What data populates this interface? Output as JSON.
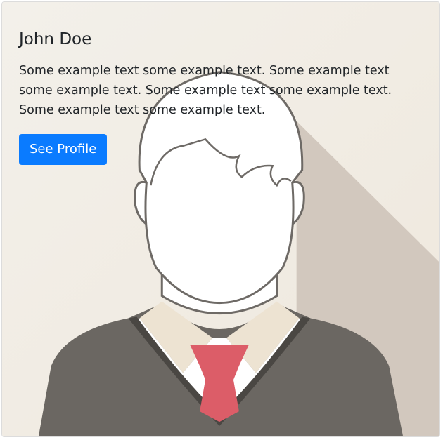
{
  "card": {
    "title": "John Doe",
    "text": "Some example text some example text. Some example text some example text. Some example text some example text. Some example text some example text.",
    "button_label": "See Profile",
    "image_icon": "male-avatar-icon"
  },
  "colors": {
    "background": "#f3eee7",
    "shadow": "#d2c8be",
    "sweater": "#6b6762",
    "tie": "#dc5d68",
    "collar": "#ede3d2",
    "button": "#0a7bff"
  }
}
